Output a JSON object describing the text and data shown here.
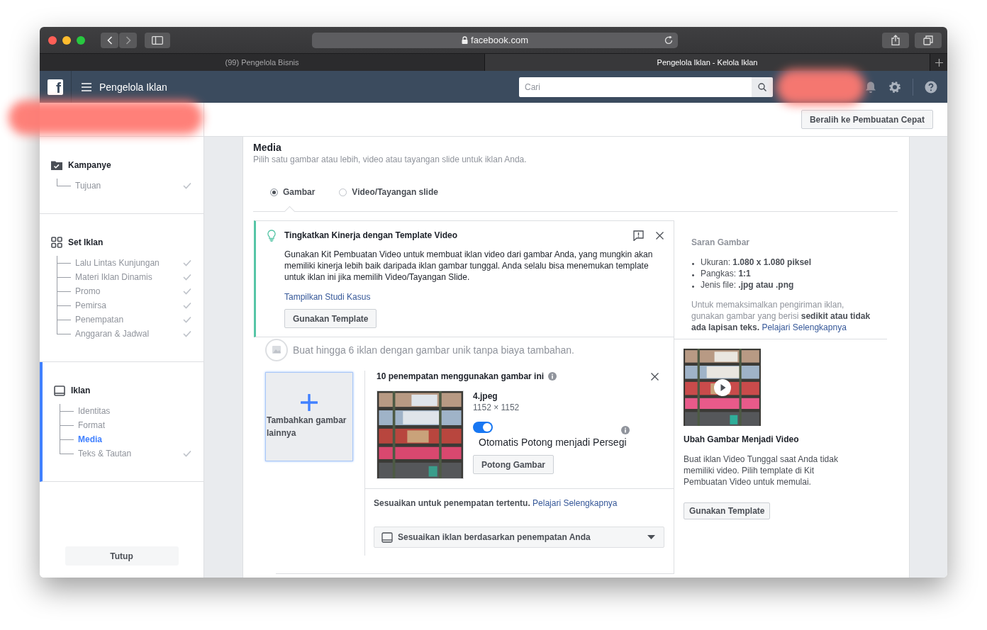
{
  "browser": {
    "address": "facebook.com",
    "tabs": [
      {
        "label": "(99) Pengelola Bisnis",
        "selected": false
      },
      {
        "label": "Pengelola Iklan - Kelola Iklan",
        "selected": true
      }
    ]
  },
  "header": {
    "logo": "f",
    "title": "Pengelola Iklan",
    "search": {
      "placeholder": "Cari"
    }
  },
  "toolbar": {
    "button": "Beralih ke Pembuatan Cepat"
  },
  "sidebar": {
    "sections": [
      {
        "title": "Kampanye",
        "selected": false,
        "children": [
          {
            "label": "Tujuan",
            "selected": false,
            "done": true
          }
        ]
      },
      {
        "title": "Set Iklan",
        "selected": false,
        "children": [
          {
            "label": "Lalu Lintas Kunjungan",
            "selected": false,
            "done": true
          },
          {
            "label": "Materi Iklan Dinamis",
            "selected": false,
            "done": true
          },
          {
            "label": "Promo",
            "selected": false,
            "done": true
          },
          {
            "label": "Pemirsa",
            "selected": false,
            "done": true
          },
          {
            "label": "Penempatan",
            "selected": false,
            "done": true
          },
          {
            "label": "Anggaran & Jadwal",
            "selected": false,
            "done": true
          }
        ]
      },
      {
        "title": "Iklan",
        "selected": true,
        "children": [
          {
            "label": "Identitas",
            "selected": false,
            "done": false
          },
          {
            "label": "Format",
            "selected": false,
            "done": false
          },
          {
            "label": "Media",
            "selected": true,
            "done": false
          },
          {
            "label": "Teks & Tautan",
            "selected": false,
            "done": true
          }
        ]
      }
    ],
    "close_button": "Tutup"
  },
  "media": {
    "title": "Media",
    "subtitle": "Pilih satu gambar atau lebih, video atau tayangan slide untuk iklan Anda.",
    "options": [
      {
        "label": "Gambar",
        "selected": true
      },
      {
        "label": "Video/Tayangan slide",
        "selected": false
      }
    ],
    "tip": {
      "title": "Tingkatkan Kinerja dengan Template Video",
      "body": "Gunakan Kit Pembuatan Video untuk membuat iklan video dari gambar Anda, yang mungkin akan memiliki kinerja lebih baik daripada iklan gambar tunggal. Anda selalu bisa menemukan template untuk iklan ini jika memilih Video/Tayangan Slide.",
      "link": "Tampilkan Studi Kasus",
      "button": "Gunakan Template"
    },
    "note": "Buat hingga 6 iklan dengan gambar unik tanpa biaya tambahan.",
    "add_image": "Tambahkan gambar lainnya",
    "placements_title": "10 penempatan menggunakan gambar ini",
    "file": {
      "name": "4.jpeg",
      "size": "1152 × 1152"
    },
    "auto_crop": {
      "label": "Otomatis Potong menjadi Persegi",
      "on": true
    },
    "crop_button": "Potong Gambar",
    "customize": {
      "text": "Sesuaikan untuk penempatan tertentu.",
      "link": "Pelajari Selengkapnya"
    },
    "dropdown": "Sesuaikan iklan berdasarkan penempatan Anda"
  },
  "suggestions": {
    "title": "Saran Gambar",
    "bullets": [
      "Ukuran: **1.080 x 1.080 piksel**",
      "Pangkas: **1:1**",
      "Jenis file: **.jpg atau .png**"
    ],
    "note": "Untuk memaksimalkan pengiriman iklan, gunakan gambar yang berisi **sedikit atau tidak ada lapisan teks.**",
    "link": "Pelajari Selengkapnya"
  },
  "video_promo": {
    "title": "Ubah Gambar Menjadi Video",
    "body": "Buat iklan Video Tunggal saat Anda tidak memiliki video. Pilih template di Kit Pembuatan Video untuk memulai.",
    "button": "Gunakan Template"
  }
}
